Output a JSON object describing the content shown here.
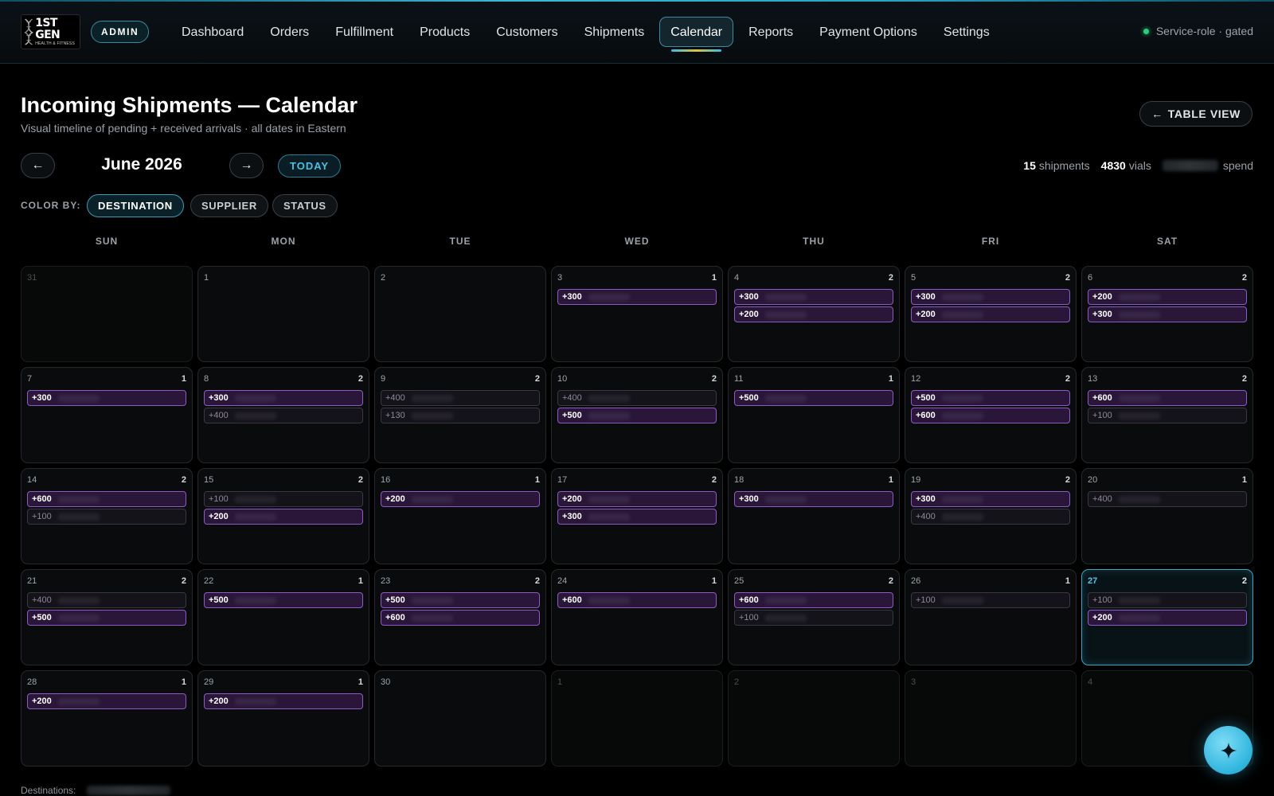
{
  "app": {
    "logo_main": "1ST GEN",
    "logo_sub": "HEALTH & FITNESS",
    "role_badge": "ADMIN",
    "service_status": "Service-role · gated",
    "accent": "#3bb8d8"
  },
  "nav": [
    {
      "label": "Dashboard",
      "active": false
    },
    {
      "label": "Orders",
      "active": false
    },
    {
      "label": "Fulfillment",
      "active": false
    },
    {
      "label": "Products",
      "active": false
    },
    {
      "label": "Customers",
      "active": false
    },
    {
      "label": "Shipments",
      "active": false
    },
    {
      "label": "Calendar",
      "active": true
    },
    {
      "label": "Reports",
      "active": false
    },
    {
      "label": "Payment Options",
      "active": false
    },
    {
      "label": "Settings",
      "active": false
    }
  ],
  "header": {
    "title": "Incoming Shipments — Calendar",
    "subtitle": "Visual timeline of pending + received arrivals · all dates in Eastern",
    "table_view_label": "TABLE VIEW",
    "table_view_arrow": "←"
  },
  "month_nav": {
    "prev_icon": "←",
    "next_icon": "→",
    "month_label": "June 2026",
    "today_label": "TODAY"
  },
  "summary": {
    "shipments_count": "15",
    "shipments_label": "shipments",
    "vials_count": "4830",
    "vials_label": "vials",
    "spend_label": "spend"
  },
  "color_by": {
    "label": "COLOR BY:",
    "options": [
      {
        "label": "DESTINATION",
        "active": true
      },
      {
        "label": "SUPPLIER",
        "active": false
      },
      {
        "label": "STATUS",
        "active": false
      }
    ]
  },
  "weekdays": [
    "SUN",
    "MON",
    "TUE",
    "WED",
    "THU",
    "FRI",
    "SAT"
  ],
  "status_colors": {
    "received": "#8a5cc4",
    "pending": "#3b3643",
    "today": "#3aa6c6"
  },
  "calendar": [
    {
      "day": "31",
      "outside": true,
      "count": "",
      "shipments": []
    },
    {
      "day": "1",
      "count": "",
      "shipments": []
    },
    {
      "day": "2",
      "count": "",
      "shipments": []
    },
    {
      "day": "3",
      "count": "1",
      "shipments": [
        {
          "qty": "+300",
          "status": "received"
        }
      ]
    },
    {
      "day": "4",
      "count": "2",
      "shipments": [
        {
          "qty": "+300",
          "status": "received"
        },
        {
          "qty": "+200",
          "status": "received"
        }
      ]
    },
    {
      "day": "5",
      "count": "2",
      "shipments": [
        {
          "qty": "+300",
          "status": "received"
        },
        {
          "qty": "+200",
          "status": "received"
        }
      ]
    },
    {
      "day": "6",
      "count": "2",
      "shipments": [
        {
          "qty": "+200",
          "status": "received"
        },
        {
          "qty": "+300",
          "status": "received"
        }
      ]
    },
    {
      "day": "7",
      "count": "1",
      "shipments": [
        {
          "qty": "+300",
          "status": "received"
        }
      ]
    },
    {
      "day": "8",
      "count": "2",
      "shipments": [
        {
          "qty": "+300",
          "status": "received"
        },
        {
          "qty": "+400",
          "status": "pending"
        }
      ]
    },
    {
      "day": "9",
      "count": "2",
      "shipments": [
        {
          "qty": "+400",
          "status": "pending"
        },
        {
          "qty": "+130",
          "status": "pending"
        }
      ]
    },
    {
      "day": "10",
      "count": "2",
      "shipments": [
        {
          "qty": "+400",
          "status": "pending"
        },
        {
          "qty": "+500",
          "status": "received"
        }
      ]
    },
    {
      "day": "11",
      "count": "1",
      "shipments": [
        {
          "qty": "+500",
          "status": "received"
        }
      ]
    },
    {
      "day": "12",
      "count": "2",
      "shipments": [
        {
          "qty": "+500",
          "status": "received"
        },
        {
          "qty": "+600",
          "status": "received"
        }
      ]
    },
    {
      "day": "13",
      "count": "2",
      "shipments": [
        {
          "qty": "+600",
          "status": "received"
        },
        {
          "qty": "+100",
          "status": "pending"
        }
      ]
    },
    {
      "day": "14",
      "count": "2",
      "shipments": [
        {
          "qty": "+600",
          "status": "received"
        },
        {
          "qty": "+100",
          "status": "pending"
        }
      ]
    },
    {
      "day": "15",
      "count": "2",
      "shipments": [
        {
          "qty": "+100",
          "status": "pending"
        },
        {
          "qty": "+200",
          "status": "received"
        }
      ]
    },
    {
      "day": "16",
      "count": "1",
      "shipments": [
        {
          "qty": "+200",
          "status": "received"
        }
      ]
    },
    {
      "day": "17",
      "count": "2",
      "shipments": [
        {
          "qty": "+200",
          "status": "received"
        },
        {
          "qty": "+300",
          "status": "received"
        }
      ]
    },
    {
      "day": "18",
      "count": "1",
      "shipments": [
        {
          "qty": "+300",
          "status": "received"
        }
      ]
    },
    {
      "day": "19",
      "count": "2",
      "shipments": [
        {
          "qty": "+300",
          "status": "received"
        },
        {
          "qty": "+400",
          "status": "pending"
        }
      ]
    },
    {
      "day": "20",
      "count": "1",
      "shipments": [
        {
          "qty": "+400",
          "status": "pending"
        }
      ]
    },
    {
      "day": "21",
      "count": "2",
      "shipments": [
        {
          "qty": "+400",
          "status": "pending"
        },
        {
          "qty": "+500",
          "status": "received"
        }
      ]
    },
    {
      "day": "22",
      "count": "1",
      "shipments": [
        {
          "qty": "+500",
          "status": "received"
        }
      ]
    },
    {
      "day": "23",
      "count": "2",
      "shipments": [
        {
          "qty": "+500",
          "status": "received"
        },
        {
          "qty": "+600",
          "status": "received"
        }
      ]
    },
    {
      "day": "24",
      "count": "1",
      "shipments": [
        {
          "qty": "+600",
          "status": "received"
        }
      ]
    },
    {
      "day": "25",
      "count": "2",
      "shipments": [
        {
          "qty": "+600",
          "status": "received"
        },
        {
          "qty": "+100",
          "status": "pending"
        }
      ]
    },
    {
      "day": "26",
      "count": "1",
      "shipments": [
        {
          "qty": "+100",
          "status": "pending"
        }
      ]
    },
    {
      "day": "27",
      "today": true,
      "count": "2",
      "shipments": [
        {
          "qty": "+100",
          "status": "pending"
        },
        {
          "qty": "+200",
          "status": "received"
        }
      ]
    },
    {
      "day": "28",
      "count": "1",
      "shipments": [
        {
          "qty": "+200",
          "status": "received"
        }
      ]
    },
    {
      "day": "29",
      "count": "1",
      "shipments": [
        {
          "qty": "+200",
          "status": "received"
        }
      ]
    },
    {
      "day": "30",
      "count": "",
      "shipments": []
    },
    {
      "day": "1",
      "outside": true,
      "count": "",
      "shipments": []
    },
    {
      "day": "2",
      "outside": true,
      "count": "",
      "shipments": []
    },
    {
      "day": "3",
      "outside": true,
      "count": "",
      "shipments": []
    },
    {
      "day": "4",
      "outside": true,
      "count": "",
      "shipments": []
    }
  ],
  "footer": {
    "destinations_label": "Destinations:"
  },
  "fab": {
    "icon": "sparkle-icon"
  }
}
